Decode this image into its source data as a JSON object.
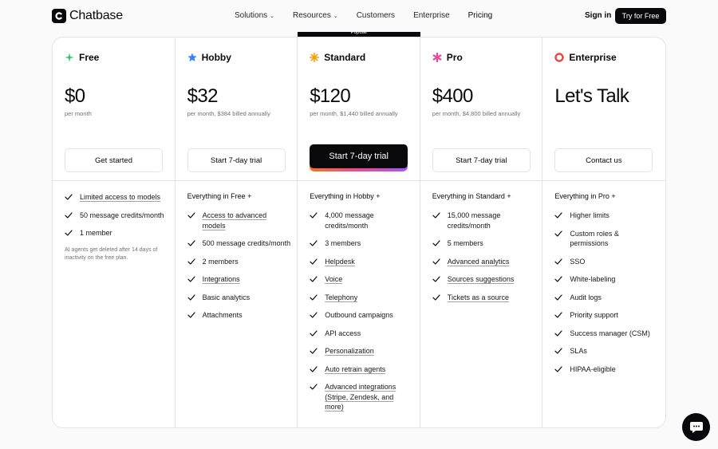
{
  "nav": {
    "brand": "Chatbase",
    "links": [
      {
        "label": "Solutions",
        "dropdown": true
      },
      {
        "label": "Resources",
        "dropdown": true
      },
      {
        "label": "Customers",
        "dropdown": false
      },
      {
        "label": "Enterprise",
        "dropdown": false
      },
      {
        "label": "Pricing",
        "dropdown": false
      }
    ],
    "signin": "Sign in",
    "try_free": "Try for Free"
  },
  "popular_label": "Popular",
  "plans": [
    {
      "name": "Free",
      "icon": "sparkle-icon",
      "icon_color": "#22c55e",
      "price": "$0",
      "billing": "per month",
      "cta": "Get started",
      "primary": false,
      "head": "",
      "features": [
        {
          "text": "Limited access to models",
          "link": true
        },
        {
          "text": "50 message credits/month",
          "link": false
        },
        {
          "text": "1 member",
          "link": false
        }
      ],
      "note": "AI agents get deleted after 14 days of inactivity on the free plan."
    },
    {
      "name": "Hobby",
      "icon": "star-icon",
      "icon_color": "#3b82f6",
      "price": "$32",
      "billing": "per month, $384 billed annually",
      "cta": "Start 7-day trial",
      "primary": false,
      "head": "Everything in Free +",
      "features": [
        {
          "text": "Access to advanced models",
          "link": true
        },
        {
          "text": "500 message credits/month",
          "link": false
        },
        {
          "text": "2 members",
          "link": false
        },
        {
          "text": "Integrations",
          "link": true
        },
        {
          "text": "Basic analytics",
          "link": false
        },
        {
          "text": "Attachments",
          "link": false
        }
      ]
    },
    {
      "name": "Standard",
      "icon": "burst-icon",
      "icon_color": "#f59e0b",
      "price": "$120",
      "billing": "per month, $1,440 billed annually",
      "cta": "Start 7-day trial",
      "primary": true,
      "head": "Everything in Hobby +",
      "features": [
        {
          "text": "4,000 message credits/month",
          "link": false
        },
        {
          "text": "3 members",
          "link": false
        },
        {
          "text": "Helpdesk",
          "link": true
        },
        {
          "text": "Voice",
          "link": true
        },
        {
          "text": "Telephony",
          "link": true
        },
        {
          "text": "Outbound campaigns",
          "link": false
        },
        {
          "text": "API access",
          "link": false
        },
        {
          "text": "Personalization",
          "link": true
        },
        {
          "text": "Auto retrain agents",
          "link": true
        },
        {
          "text": "Advanced integrations (Stripe, Zendesk, and more)",
          "link": true
        }
      ]
    },
    {
      "name": "Pro",
      "icon": "asterisk-icon",
      "icon_color": "#ec4899",
      "price": "$400",
      "billing": "per month, $4,800 billed annually",
      "cta": "Start 7-day trial",
      "primary": false,
      "head": "Everything in Standard +",
      "features": [
        {
          "text": "15,000 message credits/month",
          "link": false
        },
        {
          "text": "5 members",
          "link": false
        },
        {
          "text": "Advanced analytics",
          "link": true
        },
        {
          "text": "Sources suggestions",
          "link": true
        },
        {
          "text": "Tickets as a source",
          "link": true
        }
      ]
    },
    {
      "name": "Enterprise",
      "icon": "ring-icon",
      "icon_color": "#ef4444",
      "price": "Let's Talk",
      "billing": "",
      "cta": "Contact us",
      "primary": false,
      "head": "Everything in Pro +",
      "features": [
        {
          "text": "Higher limits",
          "link": false
        },
        {
          "text": "Custom roles & permissions",
          "link": false
        },
        {
          "text": "SSO",
          "link": false
        },
        {
          "text": "White-labeling",
          "link": false
        },
        {
          "text": "Audit logs",
          "link": false
        },
        {
          "text": "Priority support",
          "link": false
        },
        {
          "text": "Success manager (CSM)",
          "link": false
        },
        {
          "text": "SLAs",
          "link": false
        },
        {
          "text": "HIPAA-eligible",
          "link": false
        }
      ]
    }
  ]
}
